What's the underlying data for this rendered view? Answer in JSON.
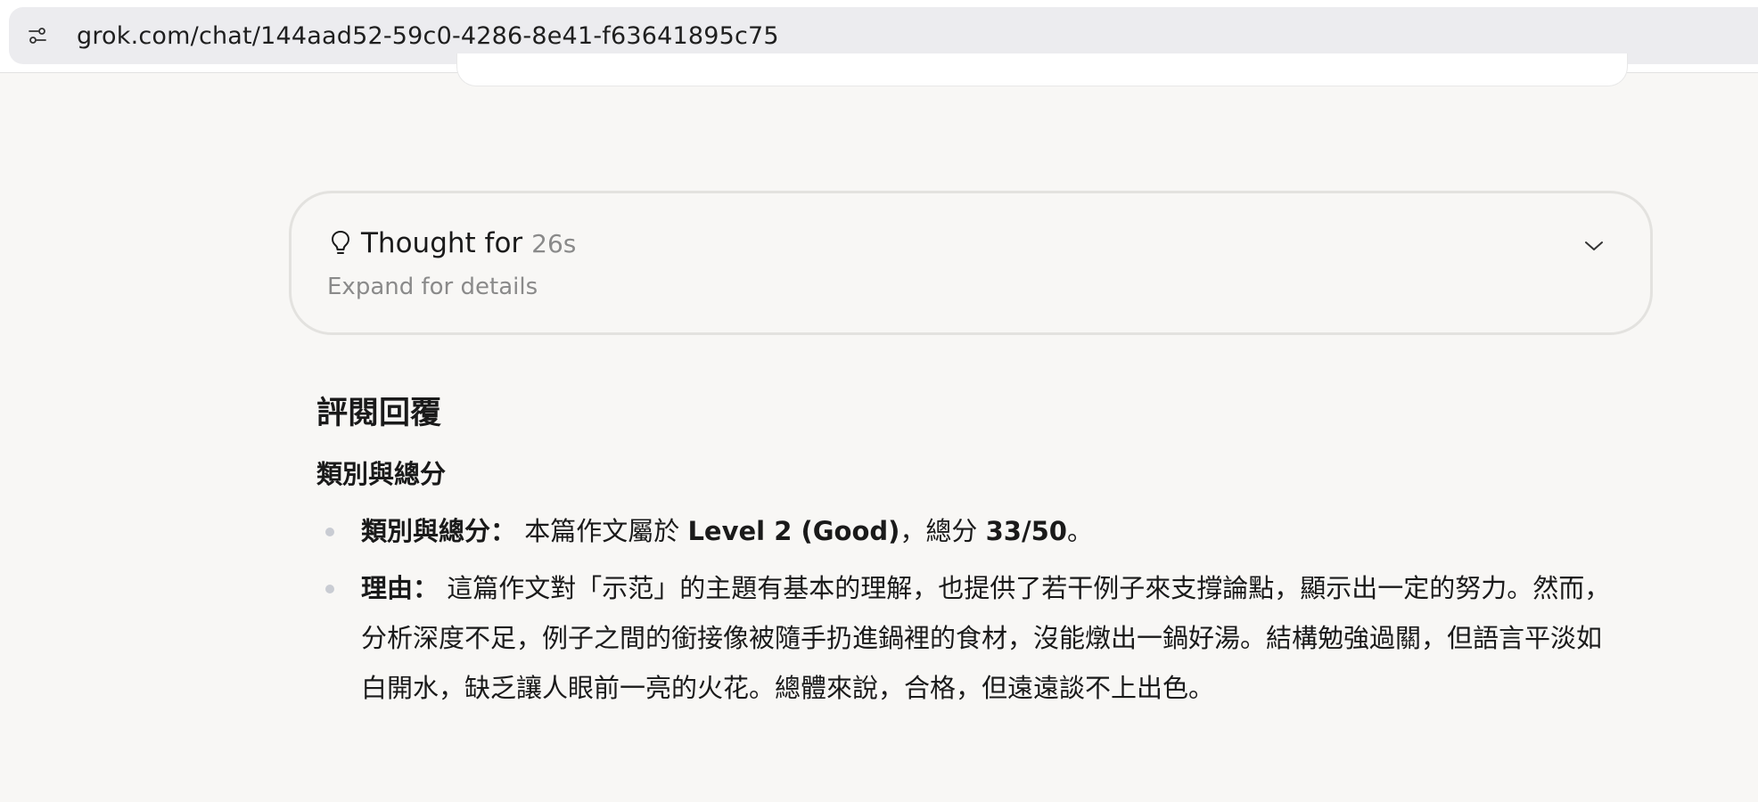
{
  "browser": {
    "url": "grok.com/chat/144aad52-59c0-4286-8e41-f63641895c75"
  },
  "thought": {
    "label": "Thought for",
    "duration": "26s",
    "expand_hint": "Expand for details"
  },
  "response": {
    "title": "評閱回覆",
    "subtitle": "類別與總分",
    "items": [
      {
        "label": "類別與總分：",
        "text_before": "本篇作文屬於 ",
        "emph_level": "Level 2 (Good)",
        "text_mid": "，總分 ",
        "emph_score": "33/50",
        "text_after": "。"
      },
      {
        "label": "理由：",
        "text": "這篇作文對「示范」的主題有基本的理解，也提供了若干例子來支撐論點，顯示出一定的努力。然而，分析深度不足，例子之間的銜接像被隨手扔進鍋裡的食材，沒能燉出一鍋好湯。結構勉強過關，但語言平淡如白開水，缺乏讓人眼前一亮的火花。總體來說，合格，但遠遠談不上出色。"
      }
    ]
  },
  "colors": {
    "page_bg": "#f8f7f5",
    "urlbar_bg": "#ececef",
    "muted_text": "#8a8a8a",
    "bullet": "#c9ccd3"
  },
  "icons": {
    "site_settings": "sliders-icon",
    "thought": "lightbulb-icon",
    "expand": "chevron-down-icon"
  }
}
